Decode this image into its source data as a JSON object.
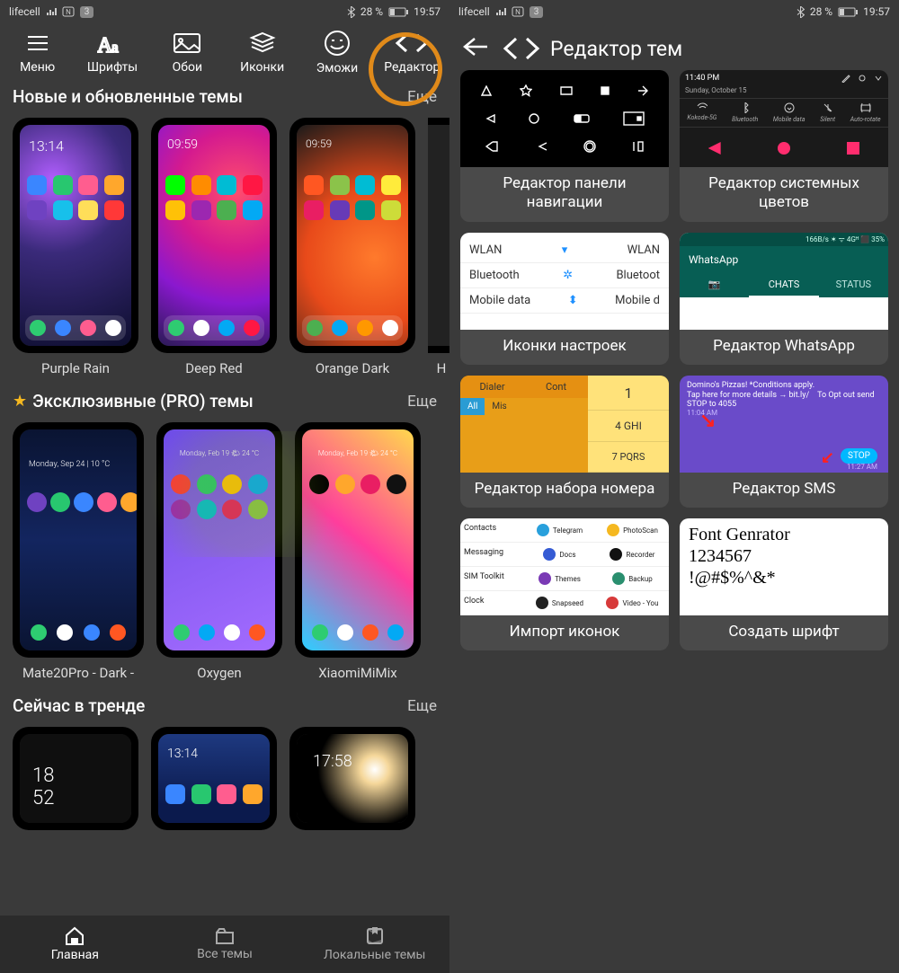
{
  "status": {
    "carrier": "lifecell",
    "badge": "3",
    "battery": "28 %",
    "time": "19:57"
  },
  "left": {
    "toolbar": {
      "menu": "Меню",
      "fonts": "Шрифты",
      "walls": "Обои",
      "icons": "Иконки",
      "emoji": "Эможи",
      "editor": "Редактор"
    },
    "sections": {
      "new": {
        "title": "Новые и обновленные темы",
        "more": "Еще"
      },
      "pro": {
        "title": "Эксклюзивные (PRO) темы",
        "more": "Еще"
      },
      "trend": {
        "title": "Сейчас в тренде",
        "more": "Еще"
      }
    },
    "themes": {
      "row1": [
        {
          "name": "Purple Rain"
        },
        {
          "name": "Deep Red"
        },
        {
          "name": "Orange Dark"
        },
        {
          "name": "H"
        }
      ],
      "row2": [
        {
          "name": "Mate20Pro - Dark -"
        },
        {
          "name": "Oxygen"
        },
        {
          "name": "XiaomiMiMix"
        }
      ]
    },
    "bottom": {
      "home": "Главная",
      "all": "Все темы",
      "local": "Локальные темы"
    }
  },
  "right": {
    "title": "Редактор тем",
    "cards": {
      "nav": "Редактор панели навигации",
      "sys": "Редактор системных цветов",
      "set": "Иконки настроек",
      "wa": "Редактор WhatsApp",
      "dial": "Редактор набора номера",
      "sms": "Редактор SMS",
      "imp": "Импорт иконок",
      "font": "Создать шрифт"
    },
    "thumbs": {
      "sys_time": "11:40 PM",
      "sys_date": "Sunday, October 15",
      "qs": [
        "Kokode-5G",
        "Bluetooth",
        "Mobile data",
        "Silent",
        "Auto-rotate"
      ],
      "settings_rows": [
        "WLAN",
        "Bluetooth",
        "Mobile data"
      ],
      "settings_right": [
        "WLAN",
        "Bluetoot",
        "Mobile d"
      ],
      "wa_title": "WhatsApp",
      "wa_tabs": [
        "CHATS",
        "STATUS"
      ],
      "wa_top": "166B/s ✶ ᯤ 4Gᴴ ⬛ 35%",
      "dial_tabs": [
        "Dialer",
        "Cont"
      ],
      "dial_sub": [
        "All",
        "Mis"
      ],
      "dial_keys": [
        "1",
        "4 GHI",
        "7 PQRS"
      ],
      "sms_text": "Domino's Pizzas! *Conditions apply.\nTap here for more details → bit.ly/    To Opt out send STOP to 4055",
      "sms_time1": "11:04 AM",
      "sms_stop": "STOP",
      "sms_time2": "11:27 AM",
      "imp_left": [
        "Contacts",
        "Messaging",
        "SIM Toolkit",
        "Clock"
      ],
      "imp_mid": [
        "Telegram",
        "Docs",
        "Themes",
        "Snapseed"
      ],
      "imp_right": [
        "PhotoScan",
        "Recorder",
        "Backup",
        "Video - You"
      ],
      "font_lines": [
        "Font Genrator",
        "1234567",
        "!@#$%^&*"
      ]
    }
  }
}
